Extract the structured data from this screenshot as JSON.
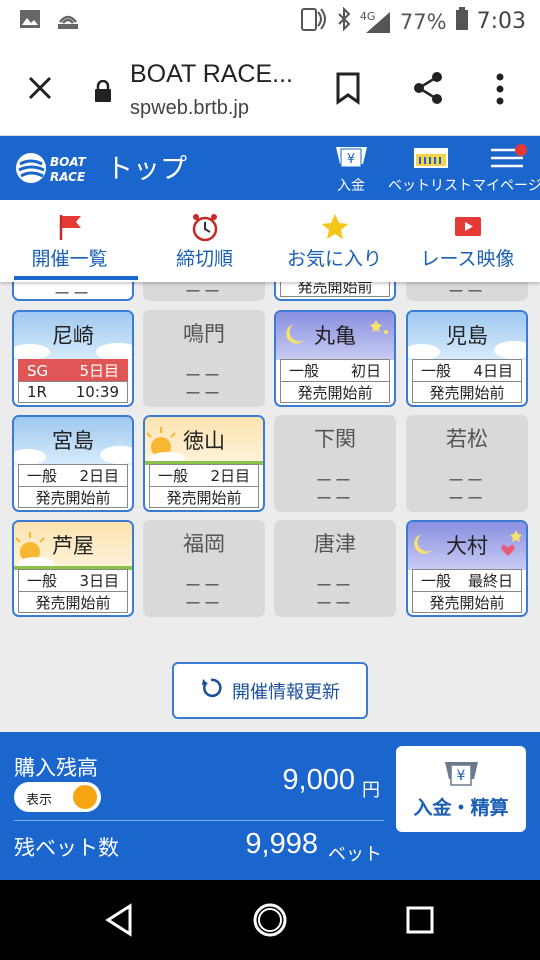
{
  "status_bar": {
    "network": "4G",
    "battery": "77%",
    "time": "7:03"
  },
  "browser": {
    "title": "BOAT RACE...",
    "url": "spweb.brtb.jp"
  },
  "app_header": {
    "logo_top": "BOAT",
    "logo_bottom": "RACE",
    "title": "トップ",
    "deposit_label": "入金",
    "betlist_label": "ベットリスト",
    "mypage_label": "マイページ"
  },
  "tabs": [
    {
      "label": "開催一覧",
      "icon": "flag-icon",
      "active": true
    },
    {
      "label": "締切順",
      "icon": "alarm-clock-icon",
      "active": false
    },
    {
      "label": "お気に入り",
      "icon": "star-icon",
      "active": false
    },
    {
      "label": "レース映像",
      "icon": "video-play-icon",
      "active": false
    }
  ],
  "partial_row": {
    "c1": "ーー",
    "c2": "ーー",
    "c3": "発売開始前",
    "c4": "ーー"
  },
  "venues": [
    {
      "name": "尼崎",
      "status": "active",
      "scene": "sky",
      "grade": "SG",
      "day": "5日目",
      "race": "1R",
      "time": "10:39"
    },
    {
      "name": "鳴門",
      "status": "inactive",
      "line1": "ーー",
      "line2": "ーー"
    },
    {
      "name": "丸亀",
      "status": "active",
      "scene": "night",
      "grade": "一般",
      "day": "初日",
      "sale": "発売開始前"
    },
    {
      "name": "児島",
      "status": "active",
      "scene": "sky",
      "grade": "一般",
      "day": "4日目",
      "sale": "発売開始前"
    },
    {
      "name": "宮島",
      "status": "active",
      "scene": "sky",
      "grade": "一般",
      "day": "2日目",
      "sale": "発売開始前"
    },
    {
      "name": "徳山",
      "status": "active",
      "scene": "morning",
      "grade": "一般",
      "day": "2日目",
      "sale": "発売開始前"
    },
    {
      "name": "下関",
      "status": "inactive",
      "line1": "ーー",
      "line2": "ーー"
    },
    {
      "name": "若松",
      "status": "inactive",
      "line1": "ーー",
      "line2": "ーー"
    },
    {
      "name": "芦屋",
      "status": "active",
      "scene": "morning",
      "grade": "一般",
      "day": "3日目",
      "sale": "発売開始前"
    },
    {
      "name": "福岡",
      "status": "inactive",
      "line1": "ーー",
      "line2": "ーー"
    },
    {
      "name": "唐津",
      "status": "inactive",
      "line1": "ーー",
      "line2": "ーー"
    },
    {
      "name": "大村",
      "status": "active",
      "scene": "night",
      "grade": "一般",
      "day": "最終日",
      "sale": "発売開始前"
    }
  ],
  "refresh_label": "開催情報更新",
  "balance": {
    "title": "購入残高",
    "toggle_label": "表示",
    "amount": "9,000",
    "amount_unit": "円",
    "bets_label": "残ベット数",
    "bets": "9,998",
    "bets_unit": "ベット",
    "deposit_button": "入金・精算"
  },
  "colors": {
    "brand_blue": "#1a66cc",
    "sg_red": "#e05656",
    "toggle_orange": "#f5a511"
  }
}
